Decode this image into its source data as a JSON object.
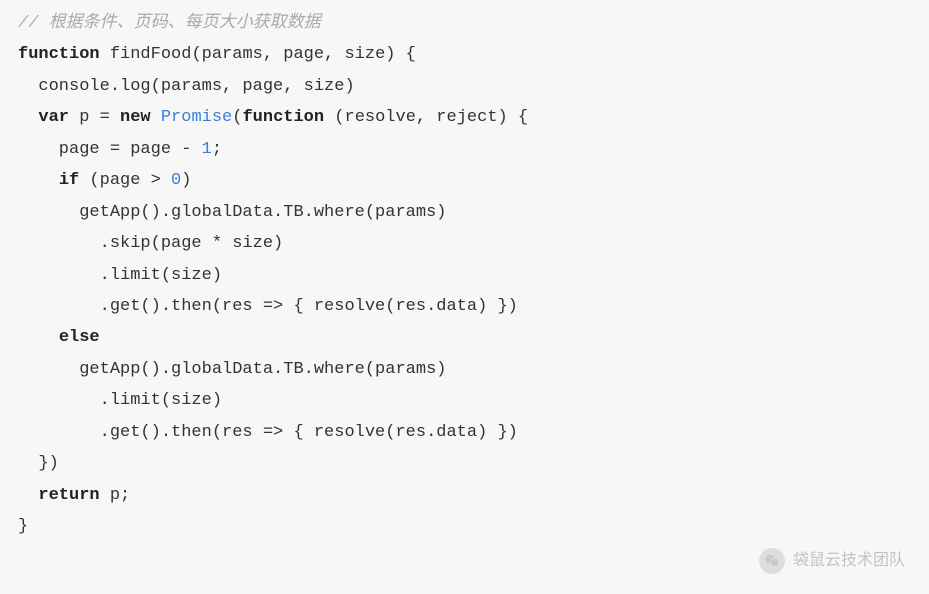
{
  "code": {
    "lines": [
      [
        {
          "cls": "tok-comment",
          "t": "// 根据条件、页码、每页大小获取数据"
        }
      ],
      [
        {
          "cls": "tok-keyword",
          "t": "function"
        },
        {
          "cls": "tok-plain",
          "t": " findFood(params, page, size) {"
        }
      ],
      [
        {
          "cls": "tok-plain",
          "t": "  console.log(params, page, size)"
        }
      ],
      [
        {
          "cls": "tok-plain",
          "t": "  "
        },
        {
          "cls": "tok-keyword",
          "t": "var"
        },
        {
          "cls": "tok-plain",
          "t": " p = "
        },
        {
          "cls": "tok-keyword",
          "t": "new"
        },
        {
          "cls": "tok-plain",
          "t": " "
        },
        {
          "cls": "tok-class",
          "t": "Promise"
        },
        {
          "cls": "tok-plain",
          "t": "("
        },
        {
          "cls": "tok-keyword",
          "t": "function"
        },
        {
          "cls": "tok-plain",
          "t": " (resolve, reject) {"
        }
      ],
      [
        {
          "cls": "tok-plain",
          "t": "    page = page - "
        },
        {
          "cls": "tok-number",
          "t": "1"
        },
        {
          "cls": "tok-plain",
          "t": ";"
        }
      ],
      [
        {
          "cls": "tok-plain",
          "t": "    "
        },
        {
          "cls": "tok-keyword",
          "t": "if"
        },
        {
          "cls": "tok-plain",
          "t": " (page > "
        },
        {
          "cls": "tok-number",
          "t": "0"
        },
        {
          "cls": "tok-plain",
          "t": ")"
        }
      ],
      [
        {
          "cls": "tok-plain",
          "t": "      getApp().globalData.TB.where(params)"
        }
      ],
      [
        {
          "cls": "tok-plain",
          "t": "        .skip(page * size)"
        }
      ],
      [
        {
          "cls": "tok-plain",
          "t": "        .limit(size)"
        }
      ],
      [
        {
          "cls": "tok-plain",
          "t": "        .get().then(res => { resolve(res.data) })"
        }
      ],
      [
        {
          "cls": "tok-plain",
          "t": "    "
        },
        {
          "cls": "tok-keyword",
          "t": "else"
        }
      ],
      [
        {
          "cls": "tok-plain",
          "t": "      getApp().globalData.TB.where(params)"
        }
      ],
      [
        {
          "cls": "tok-plain",
          "t": "        .limit(size)"
        }
      ],
      [
        {
          "cls": "tok-plain",
          "t": "        .get().then(res => { resolve(res.data) })"
        }
      ],
      [
        {
          "cls": "tok-plain",
          "t": "  })"
        }
      ],
      [
        {
          "cls": "tok-plain",
          "t": "  "
        },
        {
          "cls": "tok-keyword",
          "t": "return"
        },
        {
          "cls": "tok-plain",
          "t": " p;"
        }
      ],
      [
        {
          "cls": "tok-plain",
          "t": "}"
        }
      ]
    ]
  },
  "watermark": {
    "text": "袋鼠云技术团队"
  }
}
